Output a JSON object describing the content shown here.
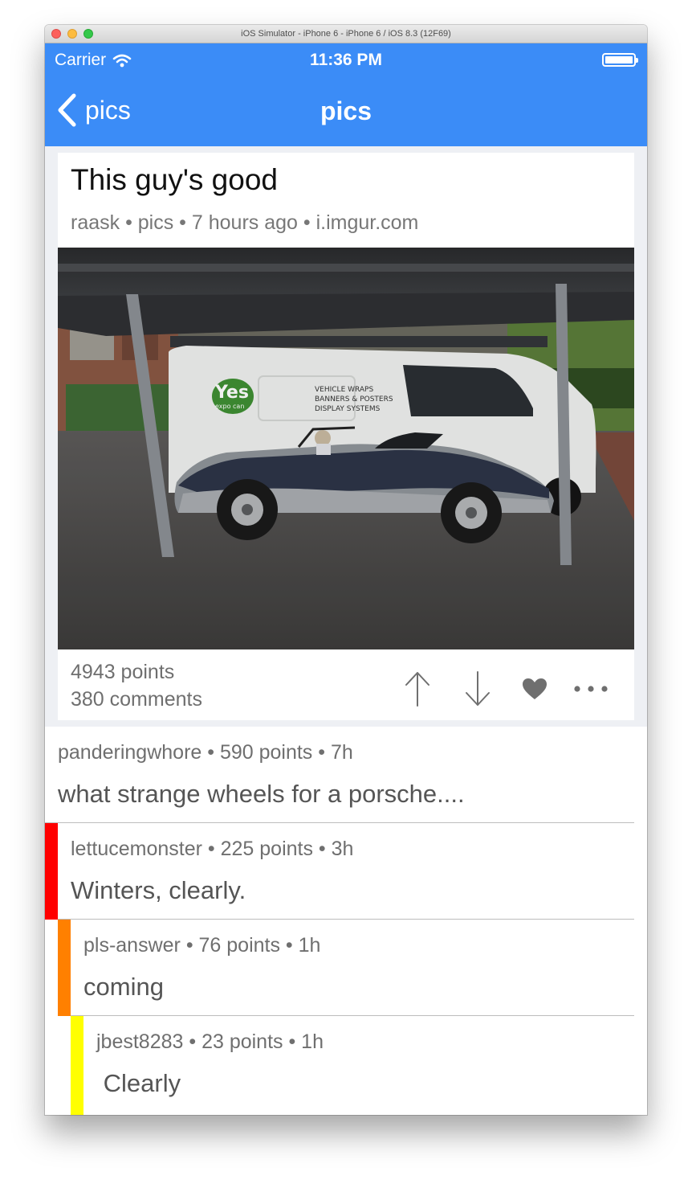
{
  "window": {
    "title": "iOS Simulator - iPhone 6 - iPhone 6 / iOS 8.3 (12F69)"
  },
  "status_bar": {
    "carrier": "Carrier",
    "time": "11:36 PM"
  },
  "nav": {
    "back_label": "pics",
    "title": "pics"
  },
  "post": {
    "title": "This guy's good",
    "meta": "raask • pics • 7 hours ago • i.imgur.com",
    "points": "4943 points",
    "comments": "380 comments",
    "image_text": {
      "logo_line1": "Yes",
      "logo_line2": "expo can",
      "sign_line1": "VEHICLE WRAPS",
      "sign_line2": "BANNERS & POSTERS",
      "sign_line3": "DISPLAY SYSTEMS"
    }
  },
  "comments": [
    {
      "meta": "panderingwhore • 590 points • 7h",
      "body": "what strange wheels for a porsche....",
      "depth": 0,
      "color": ""
    },
    {
      "meta": "lettucemonster • 225 points • 3h",
      "body": "Winters, clearly.",
      "depth": 1,
      "color": "#ff0000"
    },
    {
      "meta": "pls-answer • 76 points • 1h",
      "body": "coming",
      "depth": 2,
      "color": "#ff8000"
    },
    {
      "meta": "jbest8283 • 23 points • 1h",
      "body": " Clearly",
      "depth": 3,
      "color": "#ffff00"
    }
  ],
  "colors": {
    "nav_blue": "#3b8cf7",
    "content_bg": "#eef0f4",
    "icon_gray": "#6f6f6f"
  },
  "icons": [
    "wifi-icon",
    "battery-icon",
    "chevron-left-icon",
    "upvote-arrow-icon",
    "downvote-arrow-icon",
    "heart-icon",
    "more-icon"
  ]
}
